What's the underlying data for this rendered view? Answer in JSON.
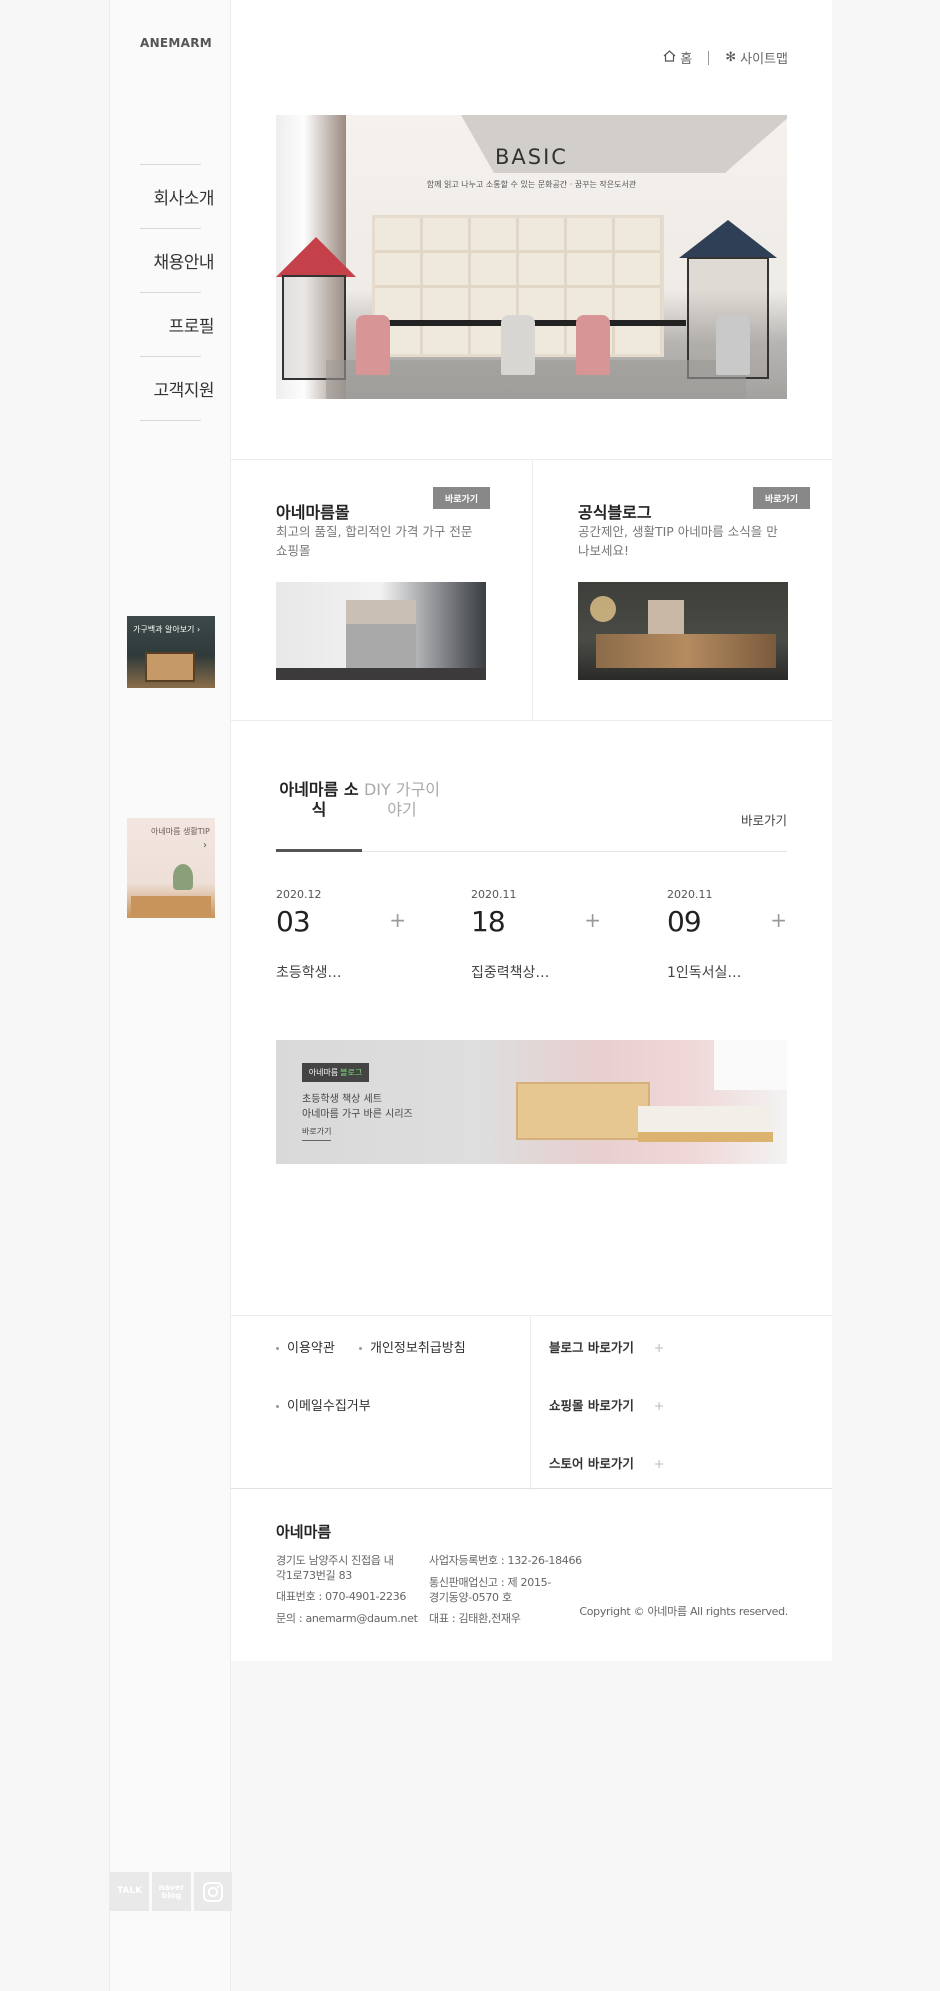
{
  "brand": {
    "logo": "ANEMARM"
  },
  "sidebar": {
    "nav": [
      {
        "label": "회사소개"
      },
      {
        "label": "채용안내"
      },
      {
        "label": "프로필"
      },
      {
        "label": "고객지원"
      }
    ],
    "banners": [
      {
        "caption": "가구백과 알아보기 ›"
      },
      {
        "caption": "아네마름 생활TIP"
      }
    ],
    "social": [
      {
        "label": "TALK"
      },
      {
        "label": "naver blog"
      },
      {
        "label": "instagram"
      }
    ]
  },
  "utility": {
    "home": "홈",
    "sitemap": "사이트맵"
  },
  "hero": {
    "title": "BASIC",
    "subtitle": "함께 읽고 나누고 소통할 수 있는 문화공간 · 꿈꾸는 작은도서관"
  },
  "promos": [
    {
      "title": "아네마름몰",
      "button": "바로가기",
      "desc": "최고의 품질, 합리적인 가격 가구 전문 쇼핑몰"
    },
    {
      "title": "공식블로그",
      "button": "바로가기",
      "desc": "공간제안, 생활TIP 아네마름 소식을 만나보세요!"
    }
  ],
  "news": {
    "tabs": [
      {
        "label": "아네마름 소식"
      },
      {
        "label": "DIY 가구이야기"
      }
    ],
    "more": "바로가기",
    "items": [
      {
        "ym": "2020.12",
        "day": "03",
        "text": "초등학생…"
      },
      {
        "ym": "2020.11",
        "day": "18",
        "text": "집중력책상…"
      },
      {
        "ym": "2020.11",
        "day": "09",
        "text": "1인독서실…"
      }
    ]
  },
  "wide_banner": {
    "tag_brand": "아네마름",
    "tag_blog": "블로그",
    "line1": "초등학생 책상 세트",
    "line2": "아네마름 가구 바른 시리즈",
    "link": "바로가기"
  },
  "footer_links": {
    "terms": "이용약관",
    "privacy": "개인정보취급방침",
    "email_refuse": "이메일수집거부",
    "blog": "블로그 바로가기",
    "mall": "쇼핑몰 바로가기",
    "store": "스토어 바로가기",
    "plus": "+"
  },
  "company": {
    "name": "아네마름",
    "address": "경기도 남양주시 진접읍 내각1로73번길 83",
    "phone": "대표번호 : 070-4901-2236",
    "email": "문의 : anemarm@daum.net",
    "biz_no": "사업자등록번호 : 132-26-18466",
    "mail_order": "통신판매업신고 : 제 2015-경기동양-0570 호",
    "ceo": "대표 : 김태환,전재우",
    "copyright": "Copyright © 아네마름 All rights reserved."
  },
  "colors": {
    "accent_gray": "#888888",
    "blog_green": "#7be07b"
  }
}
